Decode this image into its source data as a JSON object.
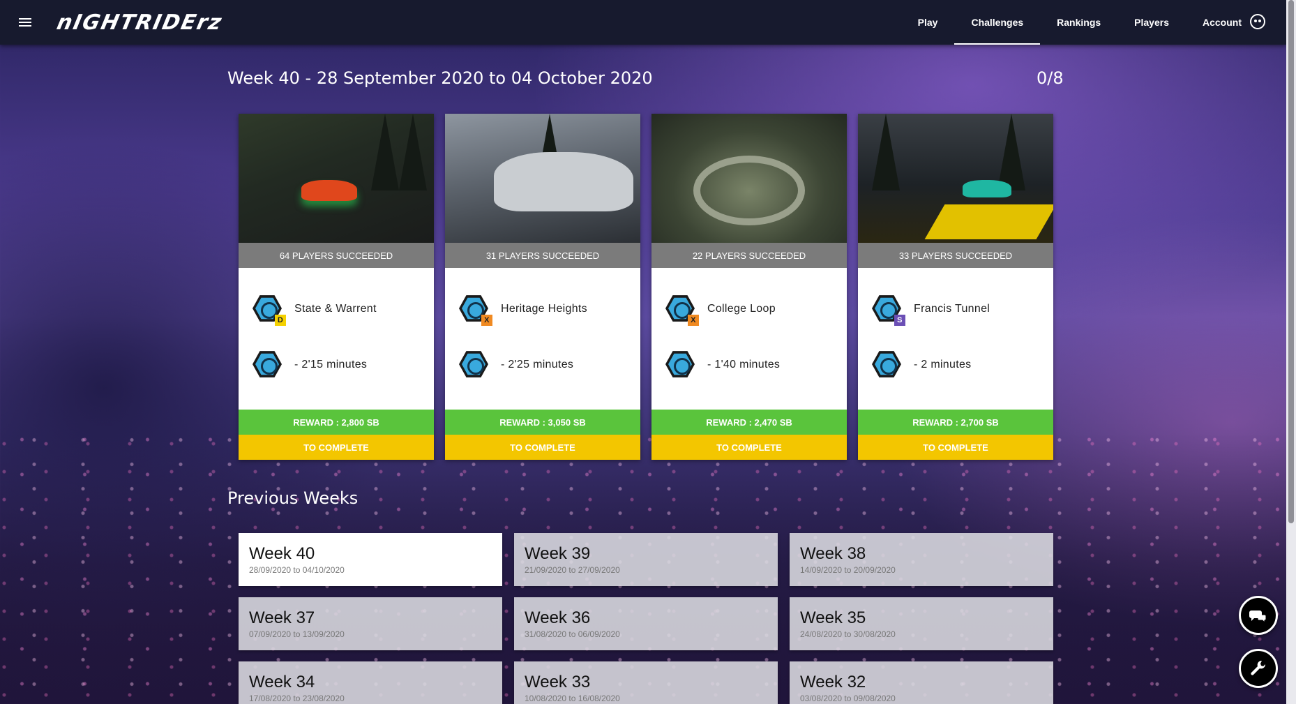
{
  "header": {
    "logo": "nIGHTRIDErz",
    "nav": [
      "Play",
      "Challenges",
      "Rankings",
      "Players",
      "Account"
    ],
    "active_nav": "Challenges"
  },
  "week": {
    "title": "Week 40 - 28 September 2020 to 04 October 2020",
    "progress": "0/8"
  },
  "challenges": [
    {
      "status": "64 PLAYERS SUCCEEDED",
      "track": "State & Warrent",
      "mode_badge": "D",
      "time": "- 2'15 minutes",
      "reward": "REWARD : 2,800 SB",
      "state": "TO COMPLETE"
    },
    {
      "status": "31 PLAYERS SUCCEEDED",
      "track": "Heritage Heights",
      "mode_badge": "X",
      "time": "- 2'25 minutes",
      "reward": "REWARD : 3,050 SB",
      "state": "TO COMPLETE"
    },
    {
      "status": "22 PLAYERS SUCCEEDED",
      "track": "College Loop",
      "mode_badge": "X",
      "time": "- 1'40 minutes",
      "reward": "REWARD : 2,470 SB",
      "state": "TO COMPLETE"
    },
    {
      "status": "33 PLAYERS SUCCEEDED",
      "track": "Francis Tunnel",
      "mode_badge": "S",
      "time": "- 2 minutes",
      "reward": "REWARD : 2,700 SB",
      "state": "TO COMPLETE"
    }
  ],
  "previous": {
    "title": "Previous Weeks",
    "weeks": [
      {
        "name": "Week 40",
        "range": "28/09/2020 to 04/10/2020"
      },
      {
        "name": "Week 39",
        "range": "21/09/2020 to 27/09/2020"
      },
      {
        "name": "Week 38",
        "range": "14/09/2020 to 20/09/2020"
      },
      {
        "name": "Week 37",
        "range": "07/09/2020 to 13/09/2020"
      },
      {
        "name": "Week 36",
        "range": "31/08/2020 to 06/09/2020"
      },
      {
        "name": "Week 35",
        "range": "24/08/2020 to 30/08/2020"
      },
      {
        "name": "Week 34",
        "range": "17/08/2020 to 23/08/2020"
      },
      {
        "name": "Week 33",
        "range": "10/08/2020 to 16/08/2020"
      },
      {
        "name": "Week 32",
        "range": "03/08/2020 to 09/08/2020"
      }
    ]
  },
  "colors": {
    "header_bg": "#171a2e",
    "reward_green": "#5ac43c",
    "complete_yellow": "#f3c600",
    "status_gray": "#7b7b7b"
  },
  "icons": [
    "menu-icon",
    "account-icon",
    "track-icon",
    "timer-icon",
    "chat-icon",
    "wrench-icon"
  ]
}
